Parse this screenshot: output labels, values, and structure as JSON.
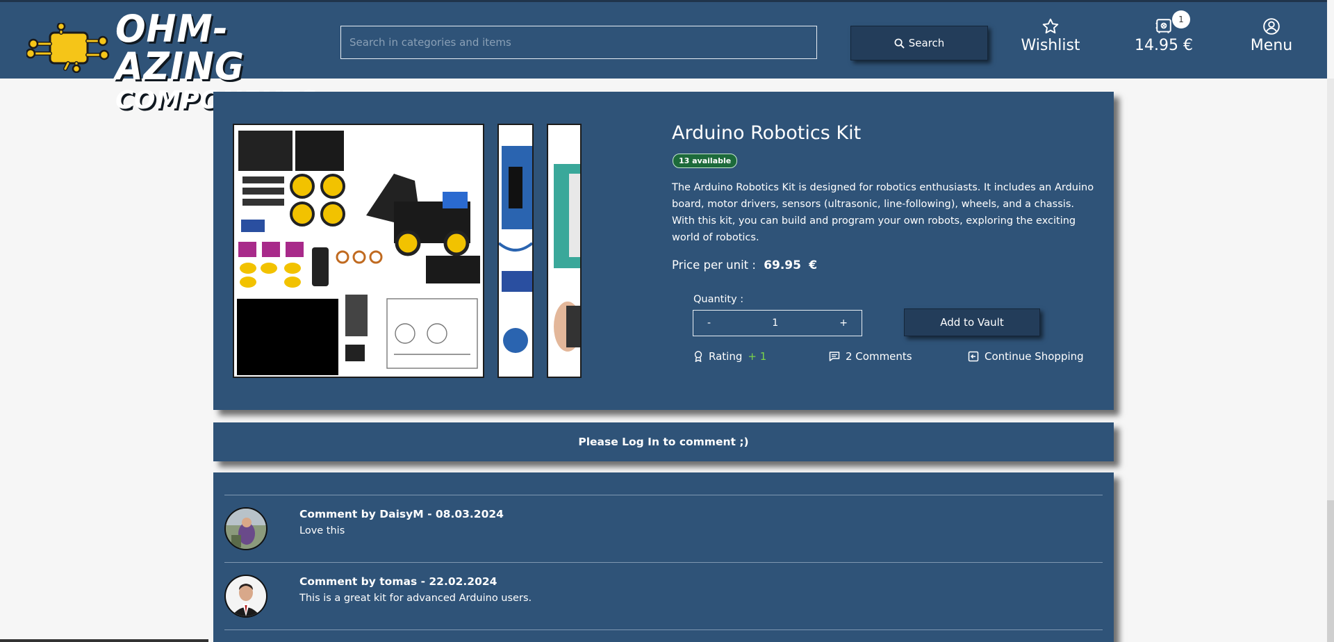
{
  "header": {
    "logo_line1": "OHM-AZING",
    "logo_line2": "COMPONENTS",
    "search_placeholder": "Search in categories and items",
    "search_button": "Search",
    "wishlist_label": "Wishlist",
    "cart_total": "14.95 €",
    "cart_count": "1",
    "menu_label": "Menu"
  },
  "product": {
    "title": "Arduino Robotics Kit",
    "availability": "13 available",
    "description": "The Arduino Robotics Kit is designed for robotics enthusiasts. It includes an Arduino board, motor drivers, sensors (ultrasonic, line-following), wheels, and a chassis. With this kit, you can build and program your own robots, exploring the exciting world of robotics.",
    "price_label": "Price per unit :",
    "price_value": "69.95",
    "currency": "€",
    "quantity_label": "Quantity :",
    "quantity_minus": "-",
    "quantity_value": "1",
    "quantity_plus": "+",
    "add_button": "Add to Vault",
    "rating_label": "Rating",
    "rating_value": "+ 1",
    "comments_link": "2 Comments",
    "continue_link": "Continue Shopping"
  },
  "login_prompt": "Please Log In to comment ;)",
  "comments": [
    {
      "header": "Comment by DaisyM - 08.03.2024",
      "text": "Love this"
    },
    {
      "header": "Comment by tomas - 22.02.2024",
      "text": "This is a great kit for advanced Arduino users."
    }
  ],
  "colors": {
    "primary": "#2f5378",
    "button": "#233d5a",
    "logo_yellow": "#f5c518",
    "badge_green": "#1d6a3b",
    "rating_green": "#7bd34a"
  }
}
